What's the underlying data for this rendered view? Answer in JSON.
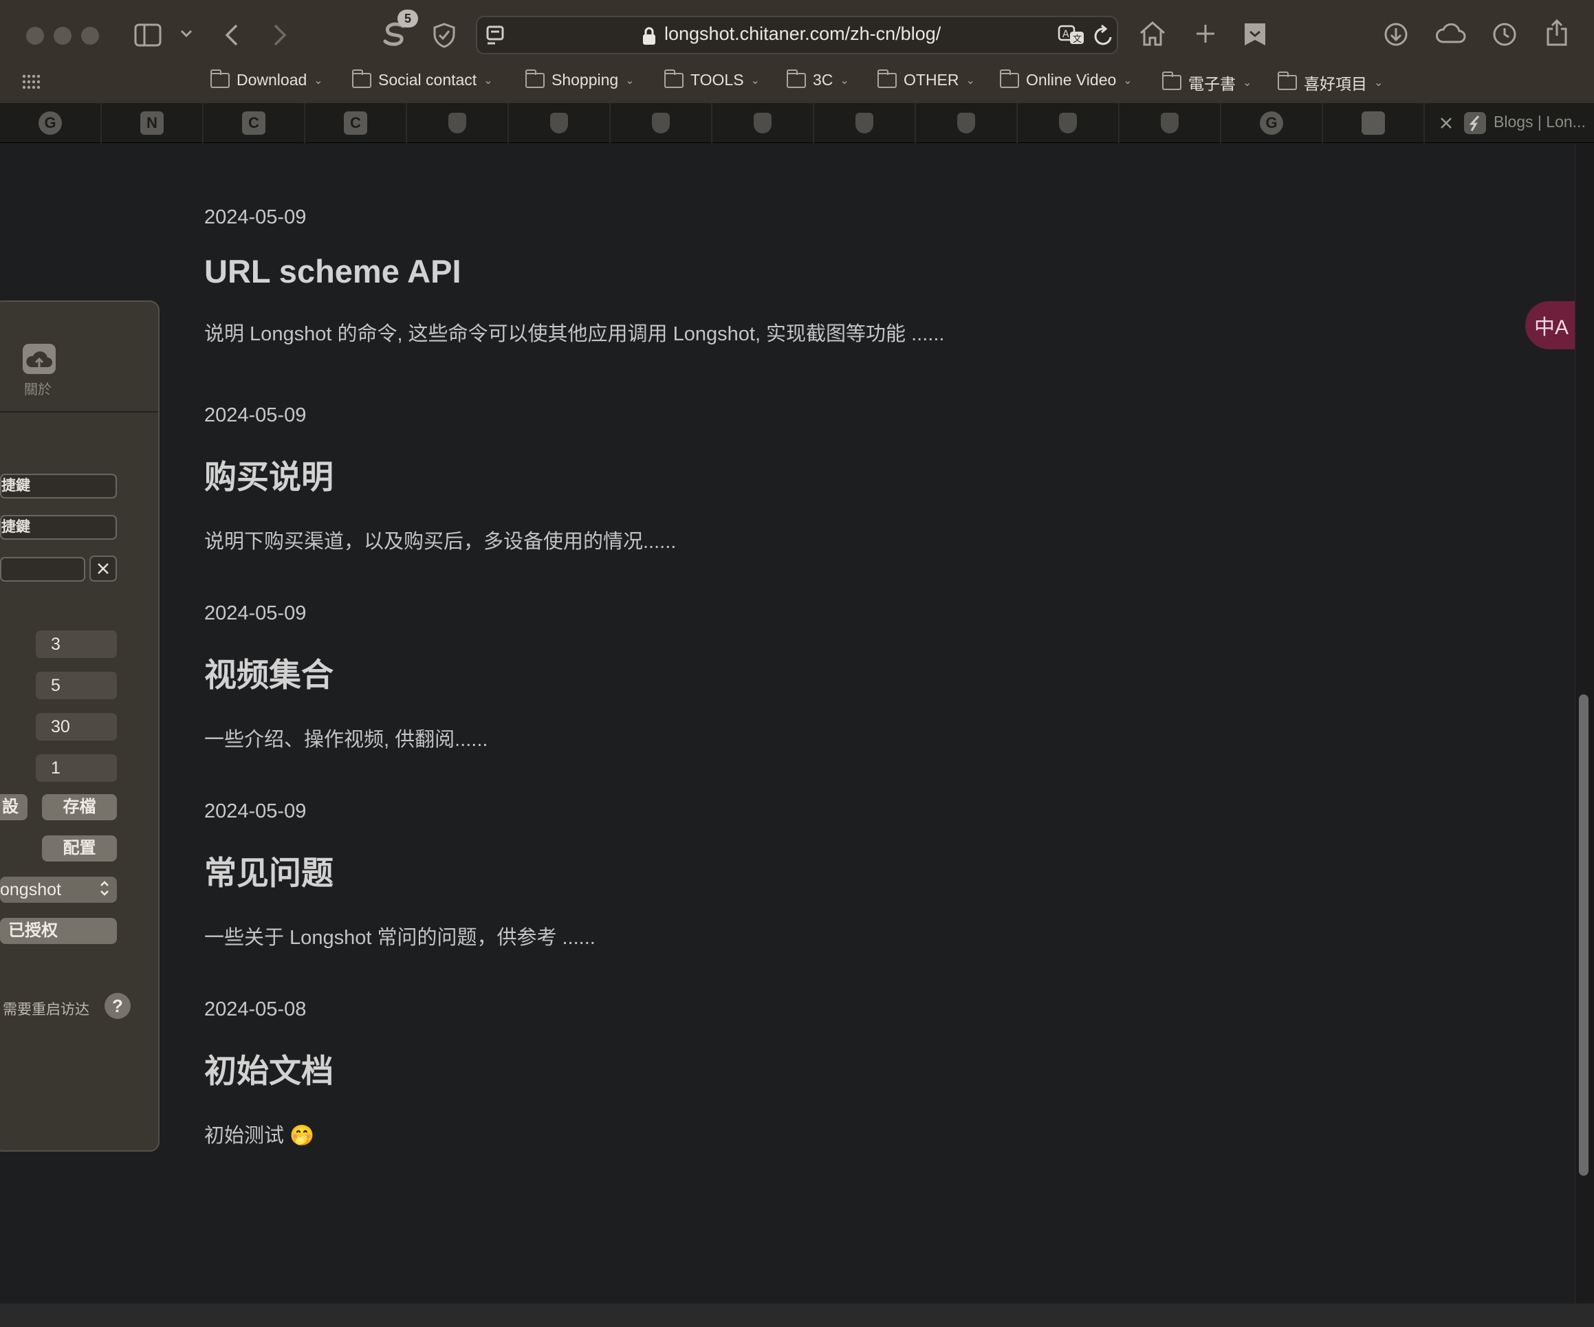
{
  "browser": {
    "tab_count_badge": "5",
    "url": "longshot.chitaner.com/zh-cn/blog/",
    "active_tab_title": "Blogs | Lon...",
    "bookmarks": [
      {
        "label": "Download"
      },
      {
        "label": "Social contact"
      },
      {
        "label": "Shopping"
      },
      {
        "label": "TOOLS"
      },
      {
        "label": "3C"
      },
      {
        "label": "OTHER"
      },
      {
        "label": "Online Video"
      },
      {
        "label": "電子書"
      },
      {
        "label": "喜好項目"
      }
    ],
    "tabs": [
      {
        "icon": "grammarly-icon",
        "glyph": "G"
      },
      {
        "icon": "notion-icon",
        "glyph": "N"
      },
      {
        "icon": "c-icon",
        "glyph": "C"
      },
      {
        "icon": "c-icon",
        "glyph": "C"
      },
      {
        "icon": "shield-icon",
        "glyph": ""
      },
      {
        "icon": "shield-icon",
        "glyph": ""
      },
      {
        "icon": "shield-icon",
        "glyph": ""
      },
      {
        "icon": "shield-icon",
        "glyph": ""
      },
      {
        "icon": "shield-icon",
        "glyph": ""
      },
      {
        "icon": "shield-icon",
        "glyph": ""
      },
      {
        "icon": "shield-icon",
        "glyph": ""
      },
      {
        "icon": "shield-icon",
        "glyph": ""
      },
      {
        "icon": "grammarly-icon",
        "glyph": "G"
      },
      {
        "icon": "longshot-icon",
        "glyph": ""
      }
    ]
  },
  "posts": [
    {
      "date": "2024-05-09",
      "title": "URL scheme API",
      "desc": "说明 Longshot 的命令, 这些命令可以使其他应用调用 Longshot, 实现截图等功能 ......"
    },
    {
      "date": "2024-05-09",
      "title": "购买说明",
      "desc": "说明下购买渠道，以及购买后，多设备使用的情况......"
    },
    {
      "date": "2024-05-09",
      "title": "视频集合",
      "desc": "一些介绍、操作视频, 供翻阅......"
    },
    {
      "date": "2024-05-09",
      "title": "常见问题",
      "desc": "一些关于 Longshot 常问的问题，供参考 ......"
    },
    {
      "date": "2024-05-08",
      "title": "初始文档",
      "desc": "初始测试 🤭"
    }
  ],
  "panel": {
    "about_label": "關於",
    "shortcut_fields": [
      "捷鍵",
      "捷鍵"
    ],
    "numbers": [
      "3",
      "5",
      "30",
      "1"
    ],
    "left_cut_button": "設",
    "save_button": "存檔",
    "config_button": "配置",
    "app_select_value": "ongshot",
    "authorized_button": "已授权",
    "help_text": "需要重启访达",
    "help_button": "?"
  },
  "translate_button": "中A",
  "colors": {
    "chrome": "#37332c",
    "page_bg": "#1d1e20",
    "translate_accent": "#6e1f3c",
    "panel_bg": "#3a3630"
  }
}
